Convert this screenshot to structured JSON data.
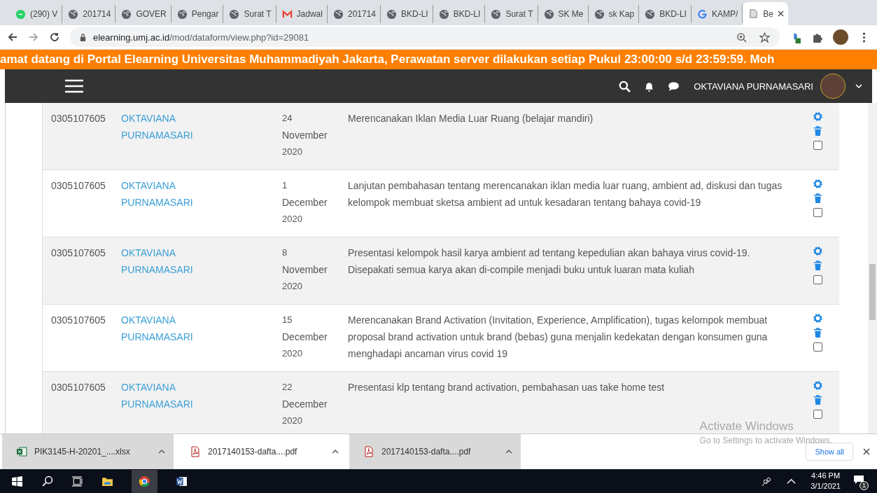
{
  "browser": {
    "tabs": [
      {
        "kind": "whatsapp",
        "title": "(290) V",
        "selected": false
      },
      {
        "kind": "globe",
        "title": "201714",
        "selected": false
      },
      {
        "kind": "globe",
        "title": "GOVER",
        "selected": false
      },
      {
        "kind": "globe",
        "title": "Pengar",
        "selected": false
      },
      {
        "kind": "globe",
        "title": "Surat T",
        "selected": false
      },
      {
        "kind": "gmail",
        "title": "Jadwal",
        "selected": false
      },
      {
        "kind": "globe",
        "title": "201714",
        "selected": false
      },
      {
        "kind": "globe",
        "title": "BKD-LI",
        "selected": false
      },
      {
        "kind": "globe",
        "title": "BKD-LI",
        "selected": false
      },
      {
        "kind": "globe",
        "title": "Surat T",
        "selected": false
      },
      {
        "kind": "globe",
        "title": "SK Me",
        "selected": false
      },
      {
        "kind": "globe",
        "title": "sk Kap",
        "selected": false
      },
      {
        "kind": "globe",
        "title": "BKD-LI",
        "selected": false
      },
      {
        "kind": "google",
        "title": "KAMP/",
        "selected": false
      },
      {
        "kind": "page",
        "title": "Be",
        "selected": true
      }
    ],
    "url_host": "elearning.umj.ac.id",
    "url_path": "/mod/dataform/view.php?id=29081"
  },
  "banner": "amat datang di Portal Elearning Universitas Muhammadiyah Jakarta, Perawatan server dilakukan setiap Pukul 23:00:00 s/d 23:59:59. Moh",
  "navbar": {
    "user_name": "OKTAVIANA PURNAMASARI"
  },
  "entries": [
    {
      "id": "0305107605",
      "name": "OKTAVIANA PURNAMASARI",
      "day": "24",
      "month": "November",
      "year": "2020",
      "description": "Merencanakan Iklan Media Luar Ruang (belajar mandiri)",
      "checked": false
    },
    {
      "id": "0305107605",
      "name": "OKTAVIANA PURNAMASARI",
      "day": "1",
      "month": "December",
      "year": "2020",
      "description": "Lanjutan pembahasan tentang merencanakan iklan media luar ruang, ambient ad, diskusi dan tugas kelompok  membuat sketsa ambient ad untuk kesadaran tentang bahaya covid-19",
      "checked": false
    },
    {
      "id": "0305107605",
      "name": "OKTAVIANA PURNAMASARI",
      "day": "8",
      "month": "November",
      "year": "2020",
      "description": "Presentasi kelompok hasil karya ambient ad tentang kepedulian akan bahaya virus covid-19. Disepakati semua karya akan di-compile menjadi buku untuk luaran mata kuliah",
      "checked": false
    },
    {
      "id": "0305107605",
      "name": "OKTAVIANA PURNAMASARI",
      "day": "15",
      "month": "December",
      "year": "2020",
      "description": "Merencanakan Brand Activation (Invitation, Experience, Amplification), tugas kelompok membuat proposal brand activation untuk brand (bebas) guna menjalin kedekatan dengan konsumen guna menghadapi ancaman virus covid 19",
      "checked": false
    },
    {
      "id": "0305107605",
      "name": "OKTAVIANA PURNAMASARI",
      "day": "22",
      "month": "December",
      "year": "2020",
      "description": "Presentasi klp tentang brand activation, pembahasan uas take home test",
      "checked": false
    }
  ],
  "activation_notice": {
    "title": "Activate Windows",
    "text": "Go to Settings to activate Windows."
  },
  "downloads": {
    "items": [
      {
        "kind": "excel",
        "name": "PIK3145-H-20201_....xlsx",
        "selected": false
      },
      {
        "kind": "pdf",
        "name": "2017140153-dafta....pdf",
        "selected": true
      },
      {
        "kind": "pdf",
        "name": "2017140153-dafta....pdf",
        "selected": false
      }
    ],
    "show_all": "Show all"
  },
  "taskbar": {
    "time": "4:46 PM",
    "date": "3/1/2021",
    "notification_count": "1"
  }
}
